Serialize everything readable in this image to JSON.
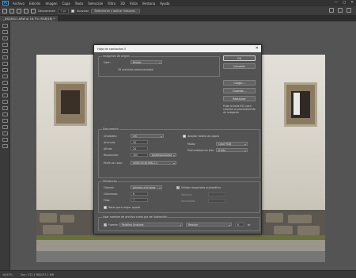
{
  "menubar": {
    "logo": "Ps",
    "items": [
      "Archivo",
      "Edición",
      "Imagen",
      "Capa",
      "Texto",
      "Selección",
      "Filtro",
      "3D",
      "Vista",
      "Ventana",
      "Ayuda"
    ],
    "controls": [
      "—",
      "□",
      "✕"
    ]
  },
  "options": {
    "feather_label": "Desvanecer:",
    "feather_value": "0 px",
    "smooth_label": "Suavizar",
    "select_mask_label": "Seleccionar y aplicar máscara..."
  },
  "document": {
    "tab_label": "_DSC6011.ARW al 16,7% (RGB/16) *"
  },
  "status": {
    "zoom": "16,67%",
    "doc_info": "Doc: 137,1 MB/137,1 MB"
  },
  "dialog": {
    "title": "Hoja de contactos II",
    "close_glyph": "✕",
    "source": {
      "title": "Imágenes de origen",
      "use_label": "Usar:",
      "use_value": "Bridge",
      "selected_note": "35 archivos seleccionados"
    },
    "document": {
      "title": "Documento",
      "units_label": "Unidades:",
      "units_value": "cm",
      "width_label": "Anchura:",
      "width_value": "30",
      "height_label": "Altura:",
      "height_value": "24",
      "resolution_label": "Resolución:",
      "resolution_value": "300",
      "resolution_unit": "píxeles/pulgada",
      "profile_label": "Perfil de color:",
      "profile_value": "sRGB IEC61966-2.1",
      "flatten_label": "Acoplar todas las capas",
      "mode_label": "Modo:",
      "mode_value": "Color RGB",
      "depth_label": "Profundidad de bits:",
      "depth_value": "8 bits"
    },
    "thumbnails": {
      "title": "Miniaturas",
      "place_label": "Colocar:",
      "place_value": "primero a lo largo",
      "columns_label": "Columnas:",
      "columns_value": "6",
      "rows_label": "Filas:",
      "rows_value": "7",
      "autospace_label": "Utilizar espaciado automático",
      "vertical_label": "Vertical:",
      "vertical_value": "",
      "horizontal_label": "Horizontal:",
      "horizontal_value": "",
      "rotate_label": "Rotar para mejor ajuste"
    },
    "caption": {
      "title": "Usar nombre de archivo como pie de ilustración",
      "font_label": "Fuente:",
      "font_value": "Palatino Linotype",
      "style_value": "Regular",
      "size_value": "8",
      "size_unit": "pt"
    },
    "buttons": {
      "ok": "OK",
      "cancel": "Cancelar",
      "load": "Cargar...",
      "save": "Guardar...",
      "reset": "Restaurar"
    },
    "info": "Pulse la tecla ESC para cancelar el procesamiento de imágenes"
  }
}
